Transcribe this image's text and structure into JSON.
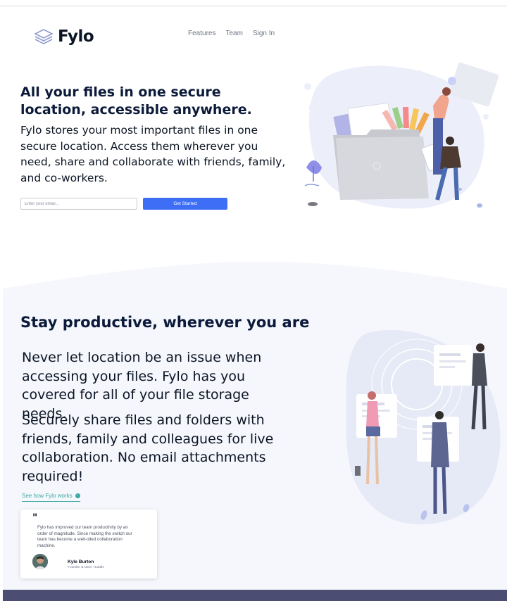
{
  "brand": {
    "name": "Fylo"
  },
  "nav": {
    "items": [
      "Features",
      "Team",
      "Sign In"
    ]
  },
  "hero": {
    "title": "All your files in one secure location, accessible anywhere.",
    "text": "Fylo stores your most important files in one secure location. Access them wherever you need, share and collaborate with friends, family, and co-workers.",
    "email_placeholder": "Enter your email...",
    "cta_label": "Get Started"
  },
  "productive": {
    "title": "Stay productive, wherever you are",
    "paragraphs": [
      "Never let location be an issue when accessing your files. Fylo has you covered for all of your file storage needs.",
      "Securely share files and folders with friends, family and colleagues for live collaboration. No email attachments required!"
    ],
    "link_label": "See how Fylo works"
  },
  "testimonial": {
    "quote_mark": "\"",
    "text": "Fylo has improved our team productivity by an order of magnitude. Since making the switch our team has become a well-oiled collaboration machine.",
    "name": "Kyle Burton",
    "role": "Founder & CEO, Huddle"
  },
  "colors": {
    "accent": "#3e6ef5",
    "link": "#3aa8a0",
    "footer": "#4b4d72",
    "section_bg": "#f5f7fd",
    "heading": "#0c1a3a"
  }
}
